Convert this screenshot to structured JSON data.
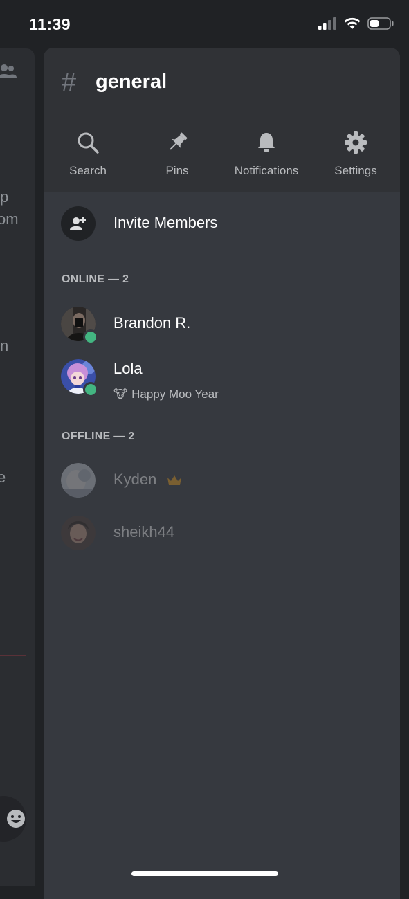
{
  "status_bar": {
    "time": "11:39"
  },
  "background_chat": {
    "text_fragments": [
      "p",
      "om",
      "n",
      "e"
    ]
  },
  "channel": {
    "hash": "#",
    "name": "general"
  },
  "toolbar": [
    {
      "label": "Search",
      "icon": "search-icon"
    },
    {
      "label": "Pins",
      "icon": "pin-icon"
    },
    {
      "label": "Notifications",
      "icon": "bell-icon"
    },
    {
      "label": "Settings",
      "icon": "gear-icon"
    }
  ],
  "invite": {
    "label": "Invite Members"
  },
  "online": {
    "header": "ONLINE — 2",
    "members": [
      {
        "name": "Brandon R.",
        "status": "online"
      },
      {
        "name": "Lola",
        "status": "online",
        "activity": "Happy Moo Year",
        "activity_emoji": "🐮"
      }
    ]
  },
  "offline": {
    "header": "OFFLINE — 2",
    "members": [
      {
        "name": "Kyden",
        "owner": true
      },
      {
        "name": "sheikh44"
      }
    ]
  },
  "colors": {
    "panel_bg": "#36393f",
    "header_bg": "#303236",
    "online_green": "#43b581",
    "crown_gold": "#faa61a"
  }
}
